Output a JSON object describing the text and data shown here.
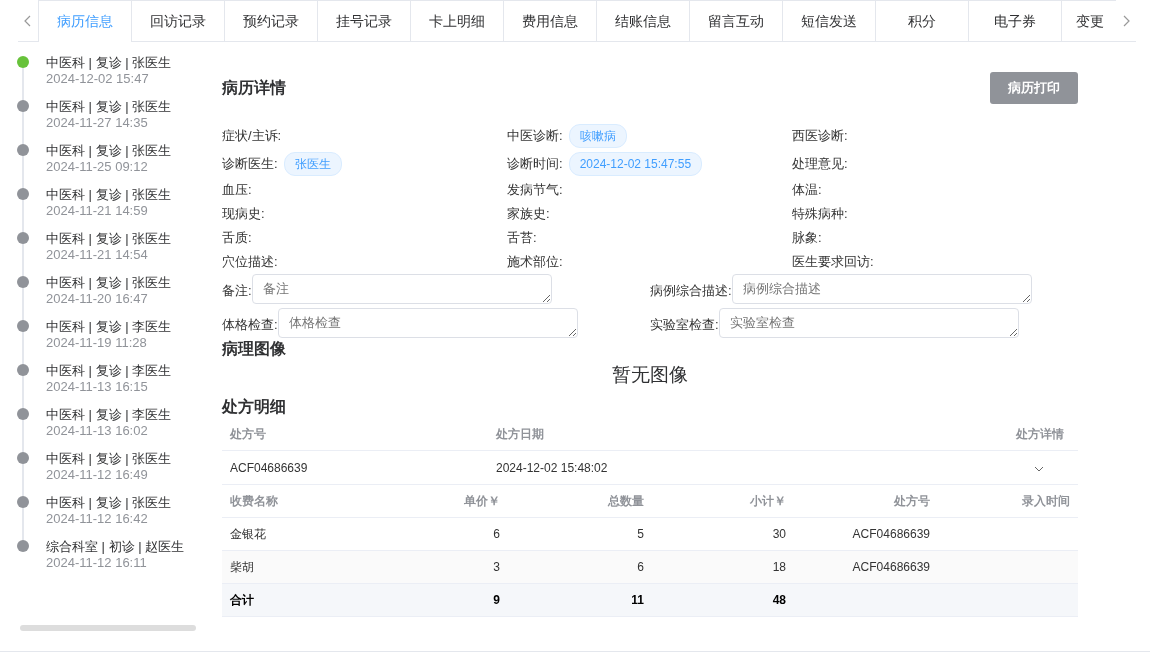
{
  "tabs": [
    {
      "label": "病历信息",
      "selected": true
    },
    {
      "label": "回访记录",
      "selected": false
    },
    {
      "label": "预约记录",
      "selected": false
    },
    {
      "label": "挂号记录",
      "selected": false
    },
    {
      "label": "卡上明细",
      "selected": false
    },
    {
      "label": "费用信息",
      "selected": false
    },
    {
      "label": "结账信息",
      "selected": false
    },
    {
      "label": "留言互动",
      "selected": false
    },
    {
      "label": "短信发送",
      "selected": false
    },
    {
      "label": "积分",
      "selected": false
    },
    {
      "label": "电子券",
      "selected": false
    },
    {
      "label": "变更",
      "selected": false
    }
  ],
  "visits": [
    {
      "title": "中医科 | 复诊 | 张医生",
      "time": "2024-12-02 15:47",
      "selected": true
    },
    {
      "title": "中医科 | 复诊 | 张医生",
      "time": "2024-11-27 14:35",
      "selected": false
    },
    {
      "title": "中医科 | 复诊 | 张医生",
      "time": "2024-11-25 09:12",
      "selected": false
    },
    {
      "title": "中医科 | 复诊 | 张医生",
      "time": "2024-11-21 14:59",
      "selected": false
    },
    {
      "title": "中医科 | 复诊 | 张医生",
      "time": "2024-11-21 14:54",
      "selected": false
    },
    {
      "title": "中医科 | 复诊 | 张医生",
      "time": "2024-11-20 16:47",
      "selected": false
    },
    {
      "title": "中医科 | 复诊 | 李医生",
      "time": "2024-11-19 11:28",
      "selected": false
    },
    {
      "title": "中医科 | 复诊 | 李医生",
      "time": "2024-11-13 16:15",
      "selected": false
    },
    {
      "title": "中医科 | 复诊 | 李医生",
      "time": "2024-11-13 16:02",
      "selected": false
    },
    {
      "title": "中医科 | 复诊 | 张医生",
      "time": "2024-11-12 16:49",
      "selected": false
    },
    {
      "title": "中医科 | 复诊 | 张医生",
      "time": "2024-11-12 16:42",
      "selected": false
    },
    {
      "title": "综合科室 | 初诊 | 赵医生",
      "time": "2024-11-12 16:11",
      "selected": false
    }
  ],
  "record": {
    "title": "病历详情",
    "print_button": "病历打印",
    "fields": [
      {
        "label": "症状/主诉:"
      },
      {
        "label": "中医诊断:",
        "value": "咳嗽病"
      },
      {
        "label": "西医诊断:"
      },
      {
        "label": "诊断医生:",
        "value": "张医生"
      },
      {
        "label": "诊断时间:",
        "value": "2024-12-02 15:47:55"
      },
      {
        "label": "处理意见:"
      },
      {
        "label": "血压:"
      },
      {
        "label": "发病节气:"
      },
      {
        "label": "体温:"
      },
      {
        "label": "现病史:"
      },
      {
        "label": "家族史:"
      },
      {
        "label": "特殊病种:"
      },
      {
        "label": "舌质:"
      },
      {
        "label": "舌苔:"
      },
      {
        "label": "脉象:"
      },
      {
        "label": "穴位描述:"
      },
      {
        "label": "施术部位:"
      },
      {
        "label": "医生要求回访:"
      }
    ],
    "notes": [
      {
        "label": "备注:",
        "placeholder": "备注"
      },
      {
        "label": "病例综合描述:",
        "placeholder": "病例综合描述"
      },
      {
        "label": "体格检查:",
        "placeholder": "体格检查"
      },
      {
        "label": "实验室检查:",
        "placeholder": "实验室检查"
      }
    ]
  },
  "pathology": {
    "title": "病理图像",
    "empty_text": "暂无图像"
  },
  "prescriptions": {
    "title": "处方明细",
    "columns": [
      "处方号",
      "处方日期",
      "处方详情"
    ],
    "rows": [
      {
        "number": "ACF04686639",
        "date": "2024-12-02 15:48:02",
        "expanded": true
      }
    ],
    "detail": {
      "columns": [
        "收费名称",
        "单价￥",
        "总数量",
        "小计￥",
        "处方号",
        "录入时间"
      ],
      "rows": [
        [
          "金银花",
          "6",
          "5",
          "30",
          "ACF04686639"
        ],
        [
          "柴胡",
          "3",
          "6",
          "18",
          "ACF04686639"
        ]
      ],
      "total": [
        "合计",
        "9",
        "11",
        "48"
      ]
    }
  }
}
